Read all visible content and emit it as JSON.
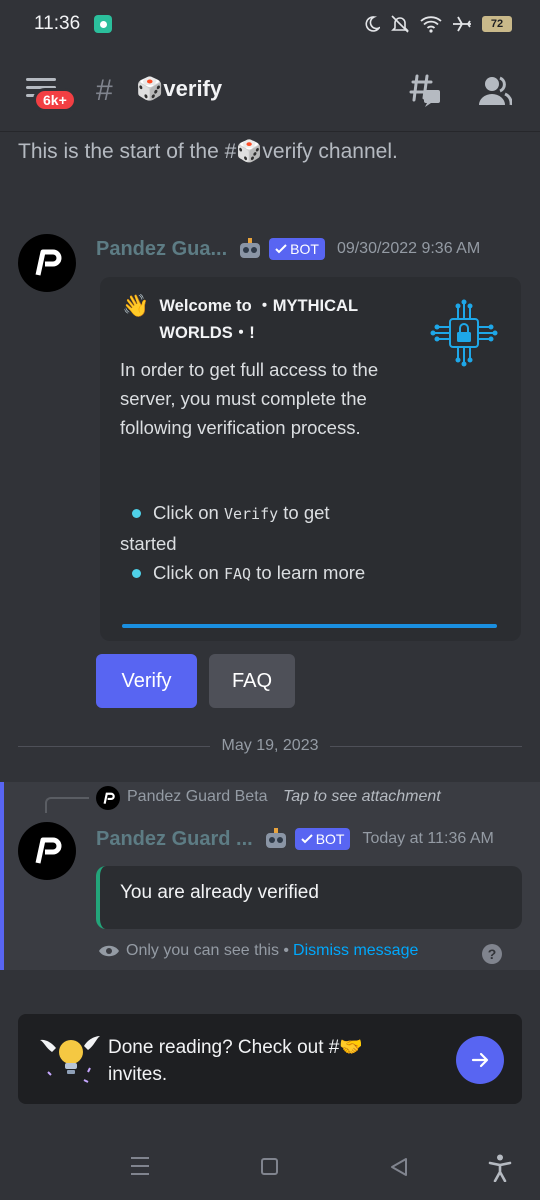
{
  "status_bar": {
    "time": "11:36",
    "battery": "72",
    "icons": [
      "moon-icon",
      "mute-icon",
      "wifi-icon",
      "airplane-icon",
      "battery-icon"
    ]
  },
  "header": {
    "badge": "6k+",
    "hash": "#",
    "channel_emoji": "🎲",
    "channel_name": "verify"
  },
  "channel_start": "This is the start of the #🎲verify channel.",
  "message1": {
    "author": "Pandez Gua...",
    "bot_tag": "BOT",
    "timestamp": "09/30/2022 9:36 AM",
    "embed": {
      "wave": "👋",
      "title": "Welcome to ・MYTHICAL WORLDS・!",
      "description": "In order to get full access to the server, you must complete the following verification process.",
      "bullets": [
        {
          "pre": "Click on ",
          "code": "Verify",
          "post": " to get started"
        },
        {
          "pre": "Click on ",
          "code": "FAQ",
          "post": " to learn more"
        }
      ]
    },
    "buttons": {
      "verify": "Verify",
      "faq": "FAQ"
    }
  },
  "date_divider": "May 19, 2023",
  "message2": {
    "reply_name": "Pandez Guard Beta",
    "reply_attachment": "Tap to see attachment",
    "author": "Pandez Guard ...",
    "bot_tag": "BOT",
    "timestamp": "Today at 11:36 AM",
    "embed_text": "You are already verified",
    "only_you": "Only you can see this • ",
    "dismiss": "Dismiss message",
    "help": "?"
  },
  "notice": {
    "text_before": "Done reading? Check out #",
    "emoji": "🤝",
    "text_after": " invites."
  },
  "colors": {
    "background": "#313338",
    "blurple": "#5865f2",
    "author": "#5d7c84",
    "ephemeral_border": "#23a57a",
    "link": "#00a8fc"
  }
}
